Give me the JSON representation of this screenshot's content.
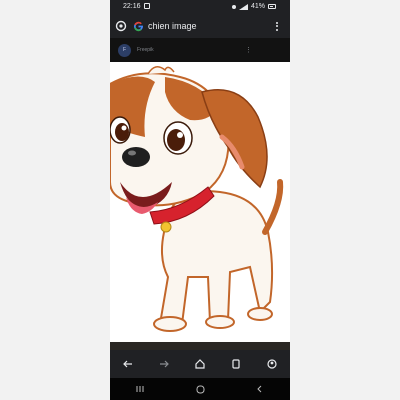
{
  "status_bar": {
    "time": "22:16",
    "battery": "41%",
    "icons": [
      "photo-icon",
      "alarm-icon",
      "wifi-icon",
      "signal-icon",
      "battery-icon"
    ]
  },
  "search": {
    "query": "chien image",
    "icons": [
      "lens-icon",
      "google-logo",
      "more-vertical-icon"
    ]
  },
  "source": {
    "avatar_text": "F",
    "name": "Freepik",
    "more_icon": "more-vertical-icon"
  },
  "image": {
    "subject": "cartoon-dog-illustration",
    "colors": {
      "body": "#fbf6ef",
      "brown": "#c2662a",
      "collar": "#d6222d",
      "tag": "#f2c230",
      "tongue": "#e85a6e"
    }
  },
  "browser_nav": [
    "back-icon",
    "forward-icon",
    "home-icon",
    "tabs-icon",
    "account-icon"
  ],
  "system_nav": [
    "recents-icon",
    "home-circle-icon",
    "back-chevron-icon"
  ],
  "theme": {
    "bar_bg": "#202124",
    "text": "#e8eaed",
    "page_bg": "#f2f2f2"
  }
}
